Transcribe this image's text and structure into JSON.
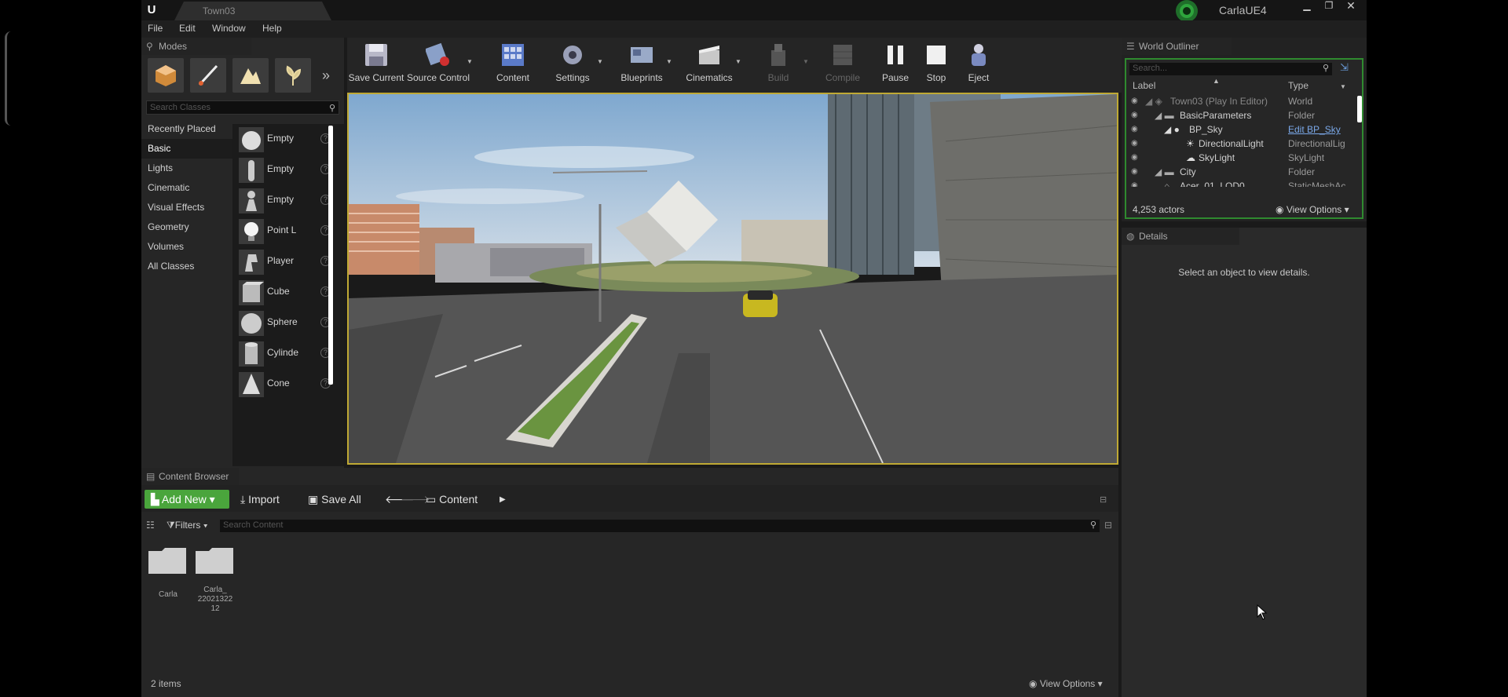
{
  "titlebar": {
    "tab": "Town03",
    "project": "CarlaUE4"
  },
  "menu": [
    "File",
    "Edit",
    "Window",
    "Help"
  ],
  "modes": {
    "title": "Modes",
    "search_placeholder": "Search Classes",
    "categories": [
      "Recently Placed",
      "Basic",
      "Lights",
      "Cinematic",
      "Visual Effects",
      "Geometry",
      "Volumes",
      "All Classes"
    ],
    "assets": [
      "Empty",
      "Empty",
      "Empty",
      "Point L",
      "Player",
      "Cube",
      "Sphere",
      "Cylinde",
      "Cone"
    ]
  },
  "toolbar": [
    {
      "label": "Save Current",
      "icon": "save-icon"
    },
    {
      "label": "Source Control",
      "icon": "source-control-icon"
    },
    {
      "label": "Content",
      "icon": "content-icon"
    },
    {
      "label": "Settings",
      "icon": "settings-icon"
    },
    {
      "label": "Blueprints",
      "icon": "blueprints-icon"
    },
    {
      "label": "Cinematics",
      "icon": "cinematics-icon"
    },
    {
      "label": "Build",
      "icon": "build-icon"
    },
    {
      "label": "Compile",
      "icon": "compile-icon"
    },
    {
      "label": "Pause",
      "icon": "pause-icon"
    },
    {
      "label": "Stop",
      "icon": "stop-icon"
    },
    {
      "label": "Eject",
      "icon": "eject-icon"
    }
  ],
  "outliner": {
    "title": "World Outliner",
    "search_placeholder": "Search...",
    "col_label": "Label",
    "col_type": "Type",
    "rows": [
      {
        "label": "Town03 (Play In Editor)",
        "type": "World"
      },
      {
        "label": "BasicParameters",
        "type": "Folder"
      },
      {
        "label": "BP_Sky",
        "type": "Edit BP_Sky"
      },
      {
        "label": "DirectionalLight",
        "type": "DirectionalLig"
      },
      {
        "label": "SkyLight",
        "type": "SkyLight"
      },
      {
        "label": "City",
        "type": "Folder"
      },
      {
        "label": "Acer_01_LOD0",
        "type": "StaticMeshAc"
      }
    ],
    "count": "4,253 actors",
    "view_options": "View Options"
  },
  "details": {
    "title": "Details",
    "message": "Select an object to view details."
  },
  "content_browser": {
    "title": "Content Browser",
    "add_new": "Add New",
    "import": "Import",
    "save_all": "Save All",
    "path": "Content",
    "filters": "Filters",
    "search_placeholder": "Search Content",
    "folders": [
      "Carla",
      "Carla_\n22021322 12"
    ],
    "count": "2 items",
    "view_options": "View Options"
  },
  "colors": {
    "accent_green": "#4aa53c",
    "viewport_border": "#bfa934",
    "outliner_border": "#2f8a2f"
  }
}
